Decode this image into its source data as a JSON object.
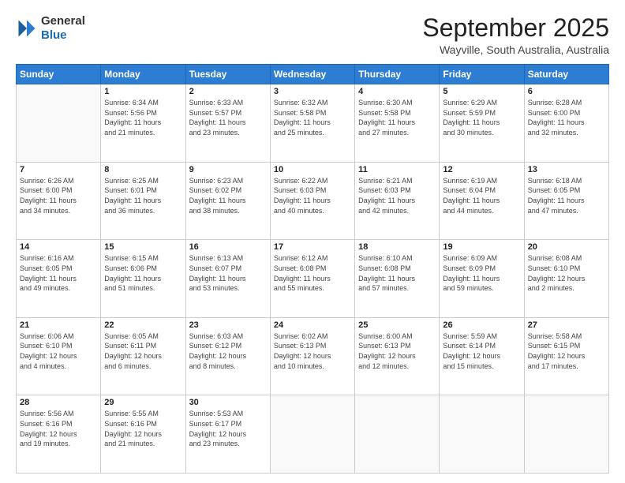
{
  "header": {
    "logo_general": "General",
    "logo_blue": "Blue",
    "month_title": "September 2025",
    "location": "Wayville, South Australia, Australia"
  },
  "days_of_week": [
    "Sunday",
    "Monday",
    "Tuesday",
    "Wednesday",
    "Thursday",
    "Friday",
    "Saturday"
  ],
  "weeks": [
    [
      {
        "day": "",
        "info": ""
      },
      {
        "day": "1",
        "info": "Sunrise: 6:34 AM\nSunset: 5:56 PM\nDaylight: 11 hours\nand 21 minutes."
      },
      {
        "day": "2",
        "info": "Sunrise: 6:33 AM\nSunset: 5:57 PM\nDaylight: 11 hours\nand 23 minutes."
      },
      {
        "day": "3",
        "info": "Sunrise: 6:32 AM\nSunset: 5:58 PM\nDaylight: 11 hours\nand 25 minutes."
      },
      {
        "day": "4",
        "info": "Sunrise: 6:30 AM\nSunset: 5:58 PM\nDaylight: 11 hours\nand 27 minutes."
      },
      {
        "day": "5",
        "info": "Sunrise: 6:29 AM\nSunset: 5:59 PM\nDaylight: 11 hours\nand 30 minutes."
      },
      {
        "day": "6",
        "info": "Sunrise: 6:28 AM\nSunset: 6:00 PM\nDaylight: 11 hours\nand 32 minutes."
      }
    ],
    [
      {
        "day": "7",
        "info": "Sunrise: 6:26 AM\nSunset: 6:00 PM\nDaylight: 11 hours\nand 34 minutes."
      },
      {
        "day": "8",
        "info": "Sunrise: 6:25 AM\nSunset: 6:01 PM\nDaylight: 11 hours\nand 36 minutes."
      },
      {
        "day": "9",
        "info": "Sunrise: 6:23 AM\nSunset: 6:02 PM\nDaylight: 11 hours\nand 38 minutes."
      },
      {
        "day": "10",
        "info": "Sunrise: 6:22 AM\nSunset: 6:03 PM\nDaylight: 11 hours\nand 40 minutes."
      },
      {
        "day": "11",
        "info": "Sunrise: 6:21 AM\nSunset: 6:03 PM\nDaylight: 11 hours\nand 42 minutes."
      },
      {
        "day": "12",
        "info": "Sunrise: 6:19 AM\nSunset: 6:04 PM\nDaylight: 11 hours\nand 44 minutes."
      },
      {
        "day": "13",
        "info": "Sunrise: 6:18 AM\nSunset: 6:05 PM\nDaylight: 11 hours\nand 47 minutes."
      }
    ],
    [
      {
        "day": "14",
        "info": "Sunrise: 6:16 AM\nSunset: 6:05 PM\nDaylight: 11 hours\nand 49 minutes."
      },
      {
        "day": "15",
        "info": "Sunrise: 6:15 AM\nSunset: 6:06 PM\nDaylight: 11 hours\nand 51 minutes."
      },
      {
        "day": "16",
        "info": "Sunrise: 6:13 AM\nSunset: 6:07 PM\nDaylight: 11 hours\nand 53 minutes."
      },
      {
        "day": "17",
        "info": "Sunrise: 6:12 AM\nSunset: 6:08 PM\nDaylight: 11 hours\nand 55 minutes."
      },
      {
        "day": "18",
        "info": "Sunrise: 6:10 AM\nSunset: 6:08 PM\nDaylight: 11 hours\nand 57 minutes."
      },
      {
        "day": "19",
        "info": "Sunrise: 6:09 AM\nSunset: 6:09 PM\nDaylight: 11 hours\nand 59 minutes."
      },
      {
        "day": "20",
        "info": "Sunrise: 6:08 AM\nSunset: 6:10 PM\nDaylight: 12 hours\nand 2 minutes."
      }
    ],
    [
      {
        "day": "21",
        "info": "Sunrise: 6:06 AM\nSunset: 6:10 PM\nDaylight: 12 hours\nand 4 minutes."
      },
      {
        "day": "22",
        "info": "Sunrise: 6:05 AM\nSunset: 6:11 PM\nDaylight: 12 hours\nand 6 minutes."
      },
      {
        "day": "23",
        "info": "Sunrise: 6:03 AM\nSunset: 6:12 PM\nDaylight: 12 hours\nand 8 minutes."
      },
      {
        "day": "24",
        "info": "Sunrise: 6:02 AM\nSunset: 6:13 PM\nDaylight: 12 hours\nand 10 minutes."
      },
      {
        "day": "25",
        "info": "Sunrise: 6:00 AM\nSunset: 6:13 PM\nDaylight: 12 hours\nand 12 minutes."
      },
      {
        "day": "26",
        "info": "Sunrise: 5:59 AM\nSunset: 6:14 PM\nDaylight: 12 hours\nand 15 minutes."
      },
      {
        "day": "27",
        "info": "Sunrise: 5:58 AM\nSunset: 6:15 PM\nDaylight: 12 hours\nand 17 minutes."
      }
    ],
    [
      {
        "day": "28",
        "info": "Sunrise: 5:56 AM\nSunset: 6:16 PM\nDaylight: 12 hours\nand 19 minutes."
      },
      {
        "day": "29",
        "info": "Sunrise: 5:55 AM\nSunset: 6:16 PM\nDaylight: 12 hours\nand 21 minutes."
      },
      {
        "day": "30",
        "info": "Sunrise: 5:53 AM\nSunset: 6:17 PM\nDaylight: 12 hours\nand 23 minutes."
      },
      {
        "day": "",
        "info": ""
      },
      {
        "day": "",
        "info": ""
      },
      {
        "day": "",
        "info": ""
      },
      {
        "day": "",
        "info": ""
      }
    ]
  ]
}
